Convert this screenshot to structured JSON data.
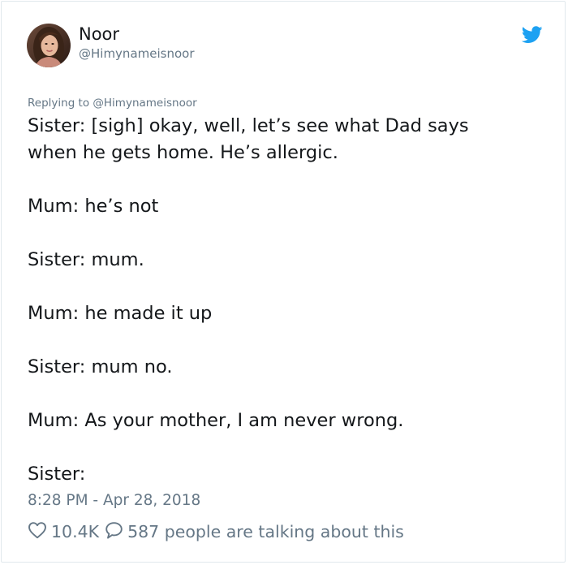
{
  "user": {
    "name": "Noor",
    "handle": "@Himynameisnoor",
    "avatar_icon": "profile-photo"
  },
  "brand": {
    "icon": "twitter-bird-icon",
    "color": "#1da1f2"
  },
  "tweet": {
    "replying_prefix": "Replying to",
    "replying_handle": "@Himynameisnoor",
    "lines": [
      "Sister: [sigh] okay, well, let’s see what Dad says",
      "when he gets home. He’s allergic.",
      "",
      "Mum: he’s not",
      "",
      "Sister: mum.",
      "",
      "Mum: he made it up",
      "",
      "Sister: mum no.",
      "",
      "Mum: As your mother, I am never wrong.",
      "",
      "Sister:"
    ],
    "timestamp": "8:28 PM - Apr 28, 2018"
  },
  "stats": {
    "likes": "10.4K",
    "like_icon": "heart-icon",
    "comments_label": "587 people are talking about this",
    "comment_icon": "speech-bubble-icon"
  },
  "colors": {
    "text": "#14171a",
    "muted": "#657786",
    "border": "#e1e8ed"
  }
}
